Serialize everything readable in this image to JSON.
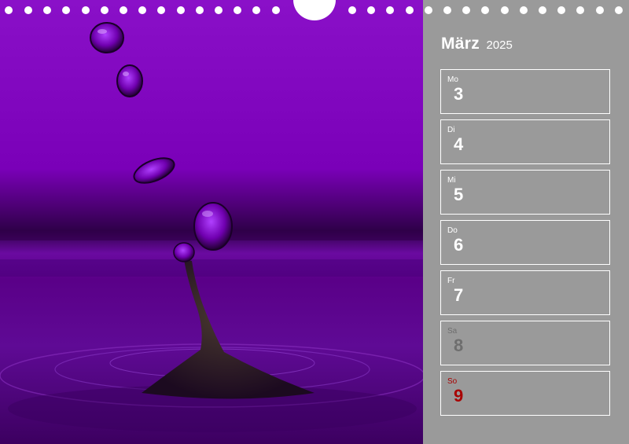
{
  "calendar": {
    "month": "März",
    "year": "2025"
  },
  "days": [
    {
      "weekday": "Mo",
      "date": "3"
    },
    {
      "weekday": "Di",
      "date": "4"
    },
    {
      "weekday": "Mi",
      "date": "5"
    },
    {
      "weekday": "Do",
      "date": "6"
    },
    {
      "weekday": "Fr",
      "date": "7"
    },
    {
      "weekday": "Sa",
      "date": "8"
    },
    {
      "weekday": "So",
      "date": "9"
    }
  ],
  "colors": {
    "panel": "#9a9a9a",
    "photo_background": "#7a00b5",
    "saturday": "#6e6e6e",
    "sunday": "#a80000",
    "text": "#ffffff"
  },
  "photo": {
    "subject": "water-drop-splash",
    "icon": "photo-image"
  }
}
